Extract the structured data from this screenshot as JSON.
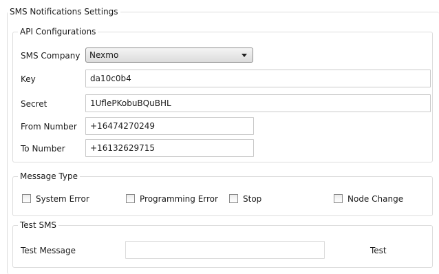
{
  "sms_settings": {
    "title": "SMS Notifications Settings",
    "api": {
      "title": "API Configurations",
      "company_label": "SMS Company",
      "company_value": "Nexmo",
      "key_label": "Key",
      "key_value": "da10c0b4",
      "secret_label": "Secret",
      "secret_value": "1UflePKobuBQuBHL",
      "from_label": "From Number",
      "from_value": "+16474270249",
      "to_label": "To Number",
      "to_value": "+16132629715"
    },
    "message_type": {
      "title": "Message Type",
      "options": [
        {
          "label": "System Error",
          "checked": false
        },
        {
          "label": "Programming Error",
          "checked": false
        },
        {
          "label": "Stop",
          "checked": false
        },
        {
          "label": "Node Change",
          "checked": false
        }
      ]
    },
    "test_sms": {
      "title": "Test SMS",
      "message_label": "Test Message",
      "message_value": "",
      "test_button_label": "Test"
    }
  }
}
